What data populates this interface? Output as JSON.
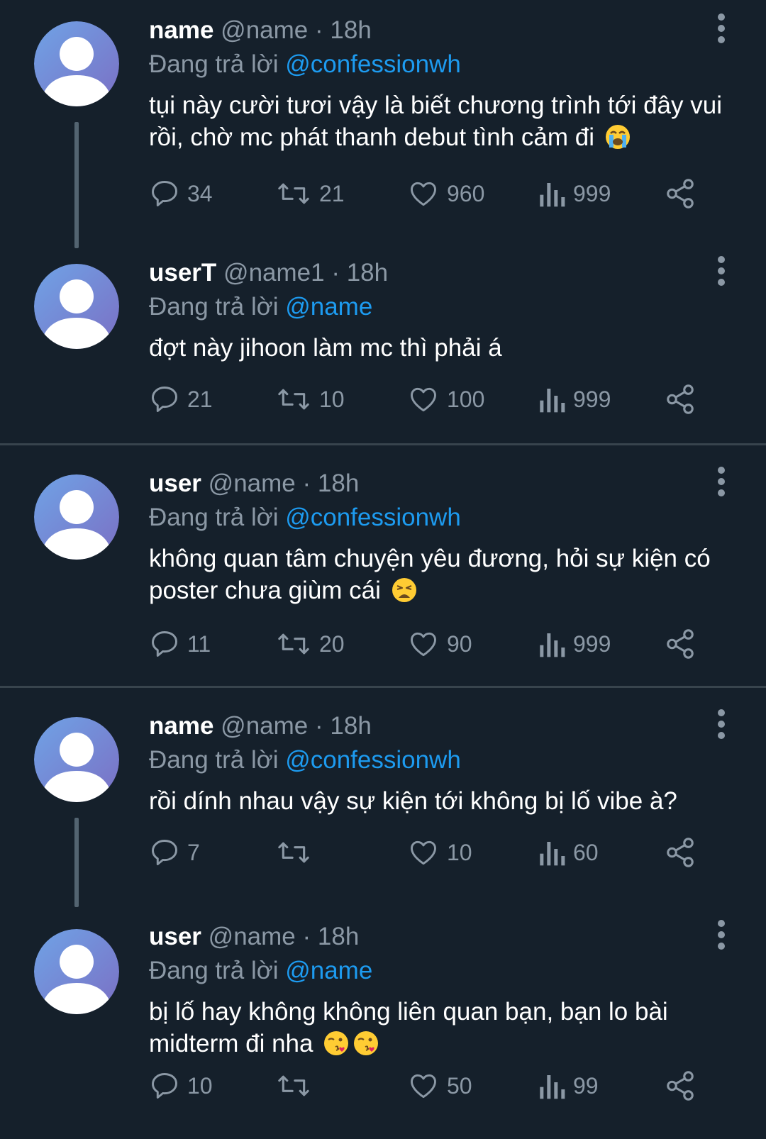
{
  "colors": {
    "background": "#15202b",
    "mention": "#1d9bf0",
    "muted": "#8b98a5",
    "divider": "#38444d"
  },
  "tweets": [
    {
      "display_name": "name",
      "handle": "@name",
      "separator": "·",
      "time": "18h",
      "replying_prefix": "Đang trả lời",
      "replying_to": "@confessionwh",
      "text": "tụi này cười tươi vậy là biết chương trình tới đây vui rồi, chờ mc phát thanh debut tình cảm đi",
      "emoji": [
        "loudly-crying-face"
      ],
      "replies": "34",
      "retweets": "21",
      "likes": "960",
      "views": "999"
    },
    {
      "display_name": "userT",
      "handle": "@name1",
      "separator": "·",
      "time": "18h",
      "replying_prefix": "Đang trả lời",
      "replying_to": "@name",
      "text": "đợt này jihoon làm mc thì phải á",
      "emoji": [],
      "replies": "21",
      "retweets": "10",
      "likes": "100",
      "views": "999"
    },
    {
      "display_name": "user",
      "handle": "@name",
      "separator": "·",
      "time": "18h",
      "replying_prefix": "Đang trả lời",
      "replying_to": "@confessionwh",
      "text": "không quan tâm chuyện yêu đương, hỏi sự kiện có poster chưa giùm cái",
      "emoji": [
        "weary-face"
      ],
      "replies": "11",
      "retweets": "20",
      "likes": "90",
      "views": "999"
    },
    {
      "display_name": "name",
      "handle": "@name",
      "separator": "·",
      "time": "18h",
      "replying_prefix": "Đang trả lời",
      "replying_to": "@confessionwh",
      "text": "rồi dính nhau vậy sự kiện tới không bị lố vibe à?",
      "emoji": [],
      "replies": "7",
      "retweets": "",
      "likes": "10",
      "views": "60"
    },
    {
      "display_name": "user",
      "handle": "@name",
      "separator": "·",
      "time": "18h",
      "replying_prefix": "Đang trả lời",
      "replying_to": "@name",
      "text": "bị lố hay không không liên quan bạn, bạn lo bài midterm đi nha",
      "emoji": [
        "kissing-face",
        "kissing-face"
      ],
      "replies": "10",
      "retweets": "",
      "likes": "50",
      "views": "99"
    }
  ]
}
